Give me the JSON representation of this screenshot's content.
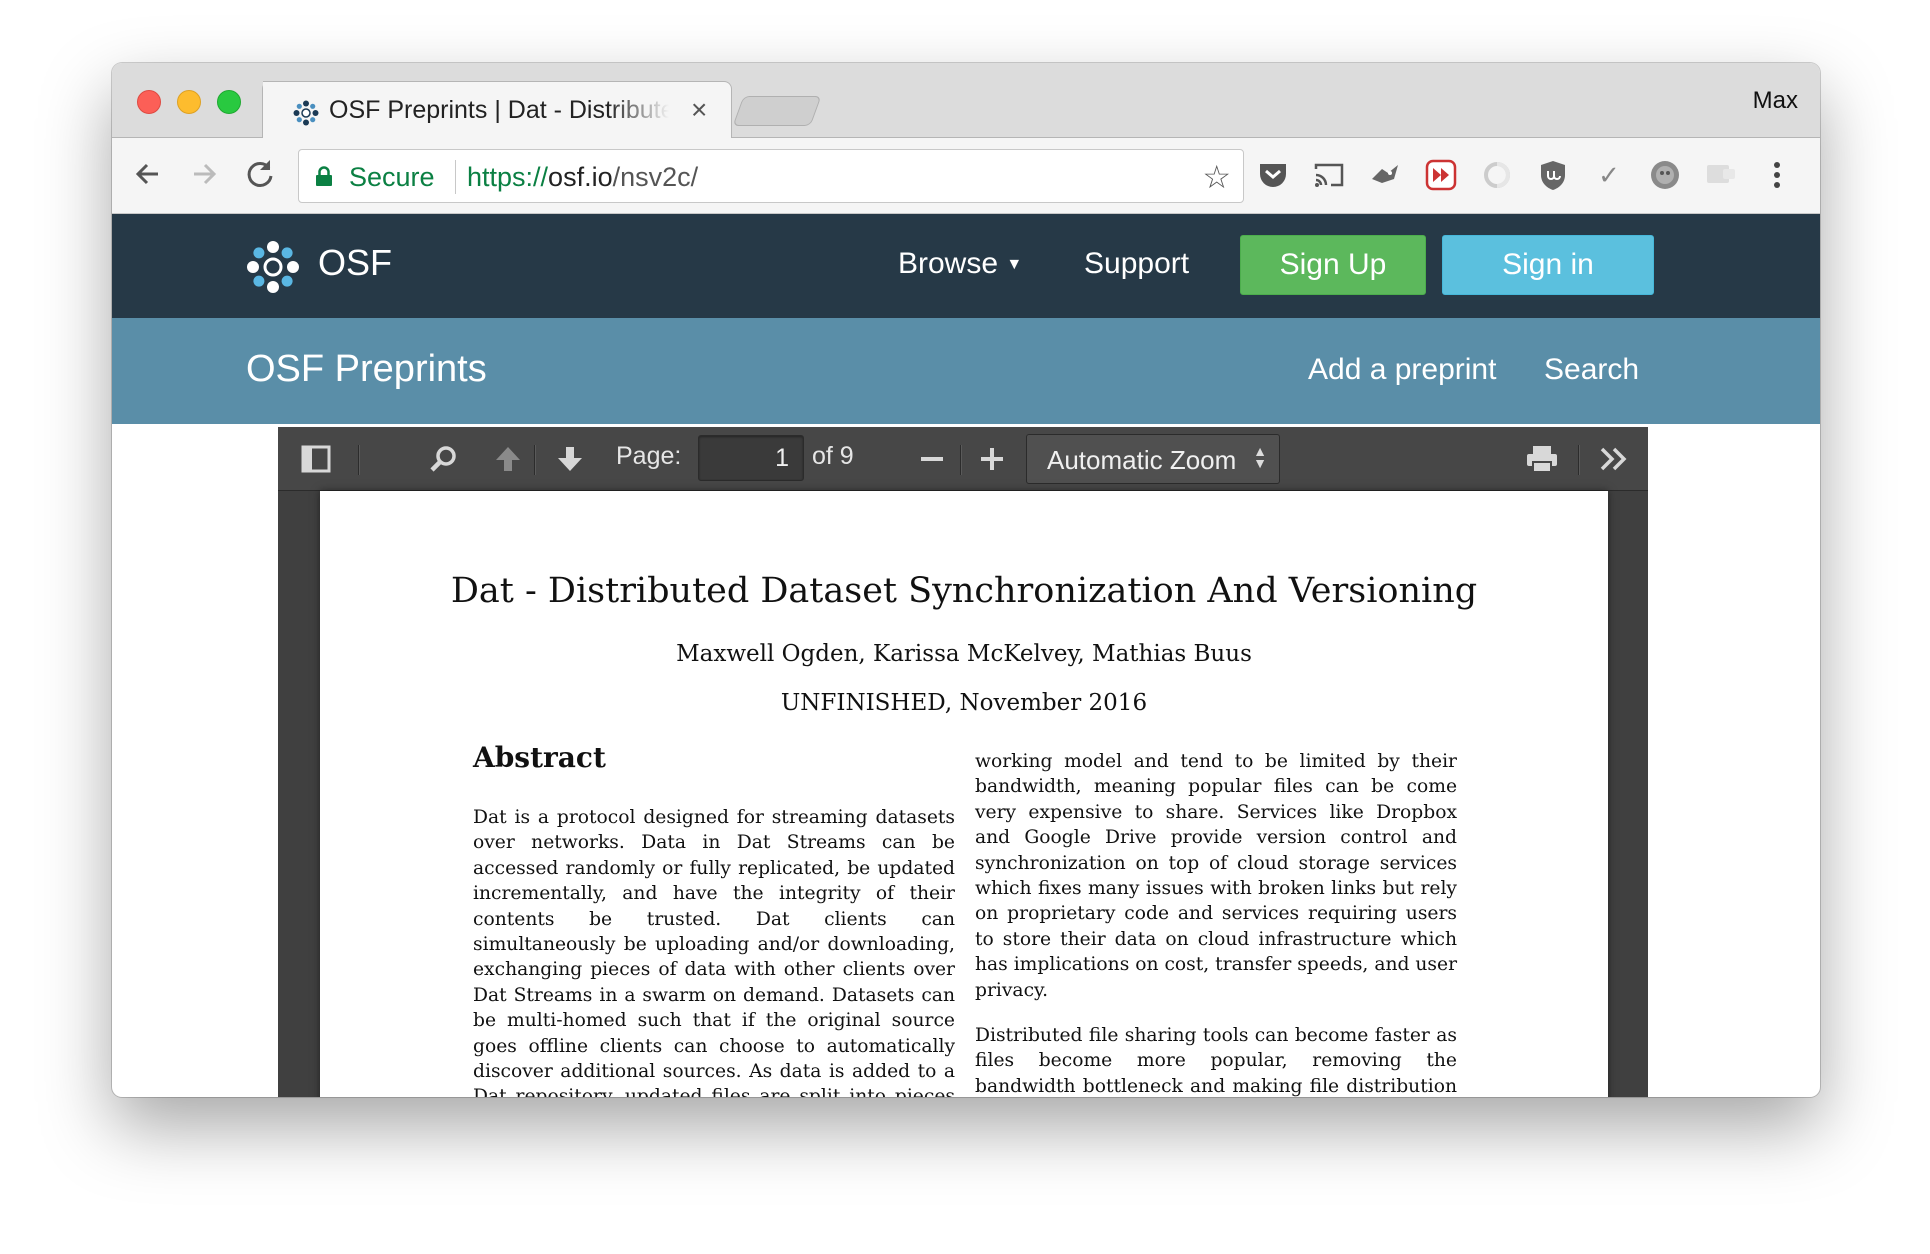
{
  "browser": {
    "tab_title": "OSF Preprints | Dat - Distributed",
    "tab_close": "×",
    "profile_name": "Max",
    "secure_label": "Secure",
    "url_scheme": "https://",
    "url_host": "osf.io",
    "url_path": "/nsv2c/",
    "icons": [
      "back-icon",
      "forward-icon",
      "reload-icon",
      "lock-icon",
      "star-icon",
      "pocket-icon",
      "cast-icon",
      "extension-icon",
      "video-speed-icon",
      "extension-icon",
      "ublock-icon",
      "check-icon",
      "avatar-icon",
      "extension-icon",
      "more-vert-icon"
    ]
  },
  "osf_nav": {
    "brand": "OSF",
    "browse": "Browse",
    "support": "Support",
    "sign_up": "Sign Up",
    "sign_in": "Sign in"
  },
  "preprints_bar": {
    "brand": "OSF Preprints",
    "add": "Add a preprint",
    "search": "Search"
  },
  "pdf_viewer": {
    "page_label": "Page:",
    "page_number": "1",
    "page_count": "of 9",
    "zoom": "Automatic Zoom"
  },
  "document": {
    "title": "Dat - Distributed Dataset Synchronization And Versioning",
    "authors": "Maxwell Ogden, Karissa McKelvey, Mathias Buus",
    "date": "UNFINISHED, November 2016",
    "abstract_heading": "Abstract",
    "abstract_text": "Dat is a protocol designed for streaming datasets over networks. Data in Dat Streams can be accessed randomly or fully replicated, be updated incrementally, and have the integrity of their contents be trusted. Dat clients can simultaneously be uploading and/or downloading, exchanging pieces of data with other clients over Dat Streams in a swarm on demand. Datasets can be multi-homed such that if the original source goes offline clients can choose to automatically discover additional sources. As data is added to a Dat repository, updated files are split into pieces using Rabin fingerprinting and deduplicated against known",
    "right_para_1": "working model and tend to be limited by their bandwidth, meaning popular files can be come very expensive to share. Services like Dropbox and Google Drive provide version control and synchronization on top of cloud storage services which fixes many issues with broken links but rely on proprietary code and services requiring users to store their data on cloud infrastructure which has implications on cost, transfer speeds, and user privacy.",
    "right_para_2": "Distributed file sharing tools can become faster as files become more popular, removing the bandwidth bottleneck and making file distribution cheaper. They also implement discovery systems which can prevent"
  }
}
